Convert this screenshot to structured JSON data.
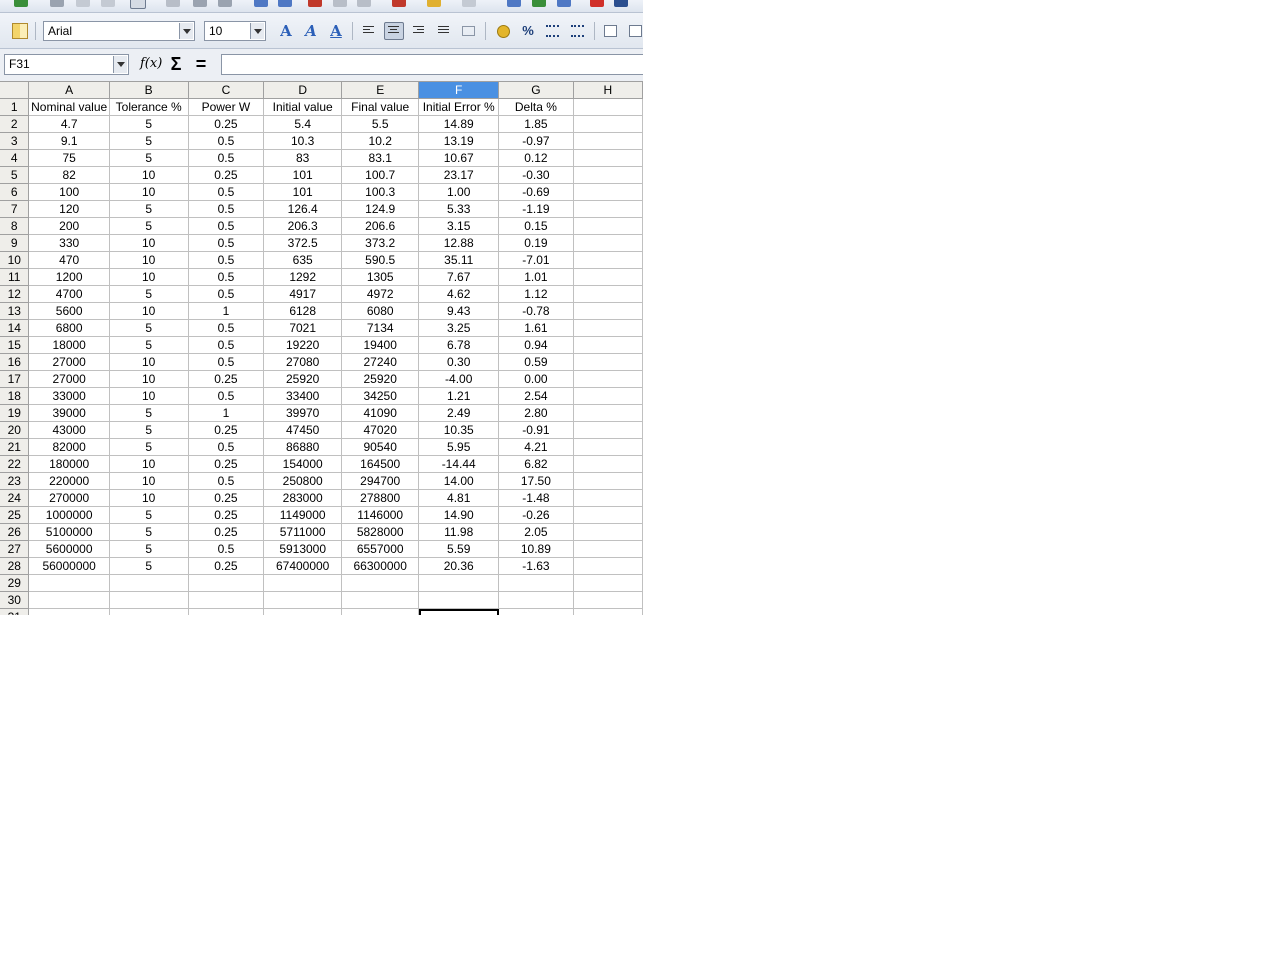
{
  "toolbar": {
    "font_name": "Arial",
    "font_size": "10",
    "percent_label": "%"
  },
  "formula_bar": {
    "name_box": "F31",
    "fx_label": "f(x)",
    "sum_label": "Σ",
    "equals_label": "=",
    "formula": ""
  },
  "sheet": {
    "columns": [
      "A",
      "B",
      "C",
      "D",
      "E",
      "F",
      "G",
      "H"
    ],
    "selected_column": "F",
    "active_cell": "F31",
    "rows": [
      [
        "Nominal value",
        "Tolerance %",
        "Power W",
        "Initial value",
        "Final value",
        "Initial Error %",
        "Delta %",
        ""
      ],
      [
        "4.7",
        "5",
        "0.25",
        "5.4",
        "5.5",
        "14.89",
        "1.85",
        ""
      ],
      [
        "9.1",
        "5",
        "0.5",
        "10.3",
        "10.2",
        "13.19",
        "-0.97",
        ""
      ],
      [
        "75",
        "5",
        "0.5",
        "83",
        "83.1",
        "10.67",
        "0.12",
        ""
      ],
      [
        "82",
        "10",
        "0.25",
        "101",
        "100.7",
        "23.17",
        "-0.30",
        ""
      ],
      [
        "100",
        "10",
        "0.5",
        "101",
        "100.3",
        "1.00",
        "-0.69",
        ""
      ],
      [
        "120",
        "5",
        "0.5",
        "126.4",
        "124.9",
        "5.33",
        "-1.19",
        ""
      ],
      [
        "200",
        "5",
        "0.5",
        "206.3",
        "206.6",
        "3.15",
        "0.15",
        ""
      ],
      [
        "330",
        "10",
        "0.5",
        "372.5",
        "373.2",
        "12.88",
        "0.19",
        ""
      ],
      [
        "470",
        "10",
        "0.5",
        "635",
        "590.5",
        "35.11",
        "-7.01",
        ""
      ],
      [
        "1200",
        "10",
        "0.5",
        "1292",
        "1305",
        "7.67",
        "1.01",
        ""
      ],
      [
        "4700",
        "5",
        "0.5",
        "4917",
        "4972",
        "4.62",
        "1.12",
        ""
      ],
      [
        "5600",
        "10",
        "1",
        "6128",
        "6080",
        "9.43",
        "-0.78",
        ""
      ],
      [
        "6800",
        "5",
        "0.5",
        "7021",
        "7134",
        "3.25",
        "1.61",
        ""
      ],
      [
        "18000",
        "5",
        "0.5",
        "19220",
        "19400",
        "6.78",
        "0.94",
        ""
      ],
      [
        "27000",
        "10",
        "0.5",
        "27080",
        "27240",
        "0.30",
        "0.59",
        ""
      ],
      [
        "27000",
        "10",
        "0.25",
        "25920",
        "25920",
        "-4.00",
        "0.00",
        ""
      ],
      [
        "33000",
        "10",
        "0.5",
        "33400",
        "34250",
        "1.21",
        "2.54",
        ""
      ],
      [
        "39000",
        "5",
        "1",
        "39970",
        "41090",
        "2.49",
        "2.80",
        ""
      ],
      [
        "43000",
        "5",
        "0.25",
        "47450",
        "47020",
        "10.35",
        "-0.91",
        ""
      ],
      [
        "82000",
        "5",
        "0.5",
        "86880",
        "90540",
        "5.95",
        "4.21",
        ""
      ],
      [
        "180000",
        "10",
        "0.25",
        "154000",
        "164500",
        "-14.44",
        "6.82",
        ""
      ],
      [
        "220000",
        "10",
        "0.5",
        "250800",
        "294700",
        "14.00",
        "17.50",
        ""
      ],
      [
        "270000",
        "10",
        "0.25",
        "283000",
        "278800",
        "4.81",
        "-1.48",
        ""
      ],
      [
        "1000000",
        "5",
        "0.25",
        "1149000",
        "1146000",
        "14.90",
        "-0.26",
        ""
      ],
      [
        "5100000",
        "5",
        "0.25",
        "5711000",
        "5828000",
        "11.98",
        "2.05",
        ""
      ],
      [
        "5600000",
        "5",
        "0.5",
        "5913000",
        "6557000",
        "5.59",
        "10.89",
        ""
      ],
      [
        "56000000",
        "5",
        "0.25",
        "67400000",
        "66300000",
        "20.36",
        "-1.63",
        ""
      ],
      [
        "",
        "",
        "",
        "",
        "",
        "",
        "",
        ""
      ],
      [
        "",
        "",
        "",
        "",
        "",
        "",
        "",
        ""
      ],
      [
        "",
        "",
        "",
        "",
        "",
        "",
        "",
        ""
      ]
    ]
  }
}
